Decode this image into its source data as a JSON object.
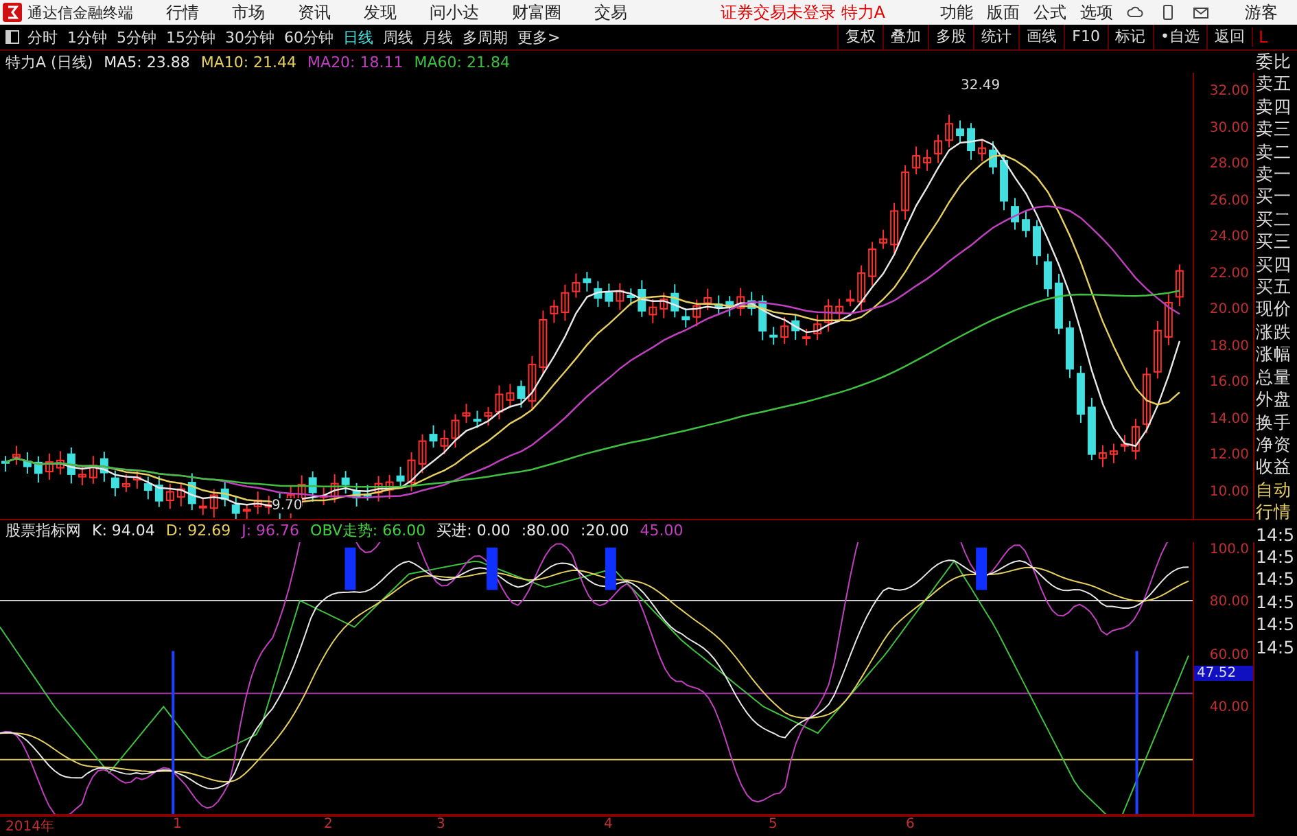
{
  "menu_bar": {
    "app_title": "通达信金融终端",
    "items": [
      "行情",
      "市场",
      "资讯",
      "发现",
      "问小达",
      "财富圈",
      "交易"
    ],
    "notice": "证券交易未登录 特力A",
    "right_items": [
      "功能",
      "版面",
      "公式",
      "选项"
    ],
    "user": "游客"
  },
  "toolbar": {
    "periods": [
      {
        "label": "分时",
        "selected": false
      },
      {
        "label": "1分钟",
        "selected": false
      },
      {
        "label": "5分钟",
        "selected": false
      },
      {
        "label": "15分钟",
        "selected": false
      },
      {
        "label": "30分钟",
        "selected": false
      },
      {
        "label": "60分钟",
        "selected": false
      },
      {
        "label": "日线",
        "selected": true
      },
      {
        "label": "周线",
        "selected": false
      },
      {
        "label": "月线",
        "selected": false
      },
      {
        "label": "多周期",
        "selected": false
      },
      {
        "label": "更多>",
        "selected": false
      }
    ],
    "buttons": [
      "复权",
      "叠加",
      "多股",
      "统计",
      "画线",
      "F10",
      "标记",
      "•自选",
      "返回"
    ],
    "corner": "L"
  },
  "price_chart": {
    "title": "特力A (日线)",
    "ma_values": [
      {
        "label": "MA5: 23.88",
        "color": "#e8e8e8"
      },
      {
        "label": "MA10: 21.44",
        "color": "#e8d060"
      },
      {
        "label": "MA20: 18.11",
        "color": "#c040c0"
      },
      {
        "label": "MA60: 21.84",
        "color": "#40c040"
      }
    ],
    "high_label": "32.49",
    "low_label": "9.70",
    "y_axis": [
      "32.00",
      "30.00",
      "28.00",
      "26.00",
      "24.00",
      "22.00",
      "20.00",
      "18.00",
      "16.00",
      "14.00",
      "12.00",
      "10.00"
    ]
  },
  "quote_panel": {
    "labels": [
      "委比",
      "卖五",
      "卖四",
      "卖三",
      "卖二",
      "卖一",
      "买一",
      "买二",
      "买三",
      "买四",
      "买五",
      "现价",
      "涨跌",
      "涨幅",
      "总量",
      "外盘",
      "换手",
      "净资",
      "收益"
    ],
    "tabs": [
      "自动",
      "行情"
    ],
    "times": [
      "14:5",
      "14:5",
      "14:5",
      "14:5",
      "14:5",
      "14:5"
    ]
  },
  "indicator": {
    "name": "股票指标网",
    "values": [
      {
        "label": "K: 94.04",
        "color": "#e8e8e8"
      },
      {
        "label": "D: 92.69",
        "color": "#e8d060"
      },
      {
        "label": "J: 96.76",
        "color": "#c040c0"
      },
      {
        "label": "OBV走势: 66.00",
        "color": "#40d040"
      },
      {
        "label": "买进: 0.00",
        "color": "#e8e8e8"
      },
      {
        "label": ":80.00",
        "color": "#e8e8e8"
      },
      {
        "label": ":20.00",
        "color": "#e8e8e8"
      },
      {
        "label": "45.00",
        "color": "#c040c0"
      }
    ],
    "y_axis": [
      "100.0",
      "80.00",
      "60.00",
      "40.00"
    ],
    "current": "47.52"
  },
  "x_axis": [
    "2014年",
    "1",
    "2",
    "3",
    "4",
    "5",
    "6"
  ]
}
